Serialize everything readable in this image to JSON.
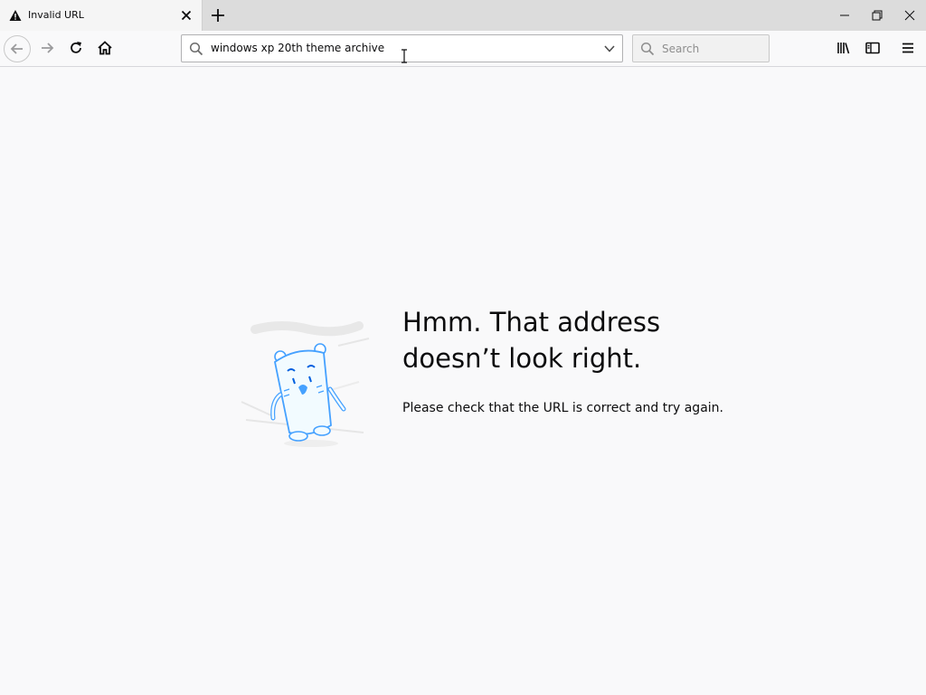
{
  "tab": {
    "title": "Invalid URL"
  },
  "toolbar": {
    "url_value": "windows xp 20th theme archive",
    "search_placeholder": "Search"
  },
  "error": {
    "title_line1": "Hmm. That address",
    "title_line2": "doesn’t look right.",
    "description": "Please check that the URL is correct and try again."
  },
  "colors": {
    "accent_blue": "#45a1ff",
    "text": "#0c0c0d",
    "page_bg": "#f9f9fa"
  }
}
